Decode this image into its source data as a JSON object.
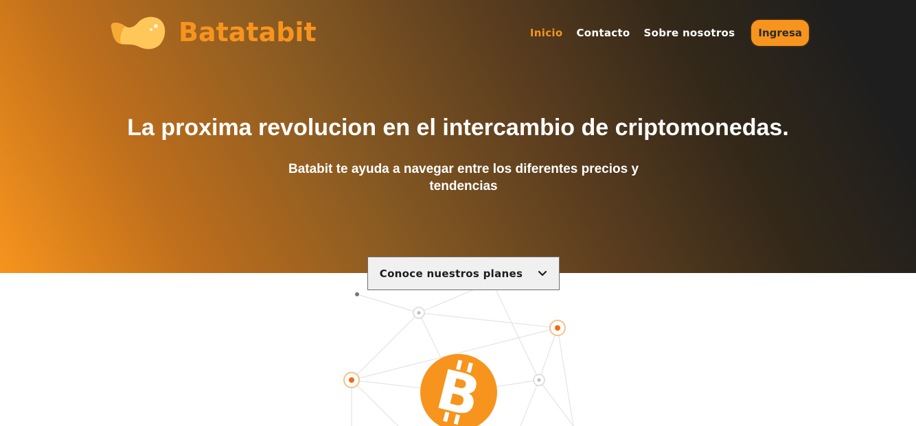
{
  "brand": {
    "name": "Batatabit",
    "logo_icon": "potato-chip-logo-icon",
    "accent_color": "#f7941d"
  },
  "nav": {
    "items": [
      {
        "label": "Inicio",
        "active": true
      },
      {
        "label": "Contacto",
        "active": false
      },
      {
        "label": "Sobre nosotros",
        "active": false
      }
    ],
    "cta_label": "Ingresa"
  },
  "hero": {
    "title": "La proxima revolucion en el intercambio de criptomonedas.",
    "subtitle": "Batabit te ayuda a navegar entre los diferentes precios y tendencias",
    "plans_button_label": "Conoce nuestros planes",
    "plans_button_icon": "chevron-down-icon"
  },
  "illustration": {
    "icon": "bitcoin-network-icon",
    "coin_symbol": "bitcoin-icon"
  }
}
